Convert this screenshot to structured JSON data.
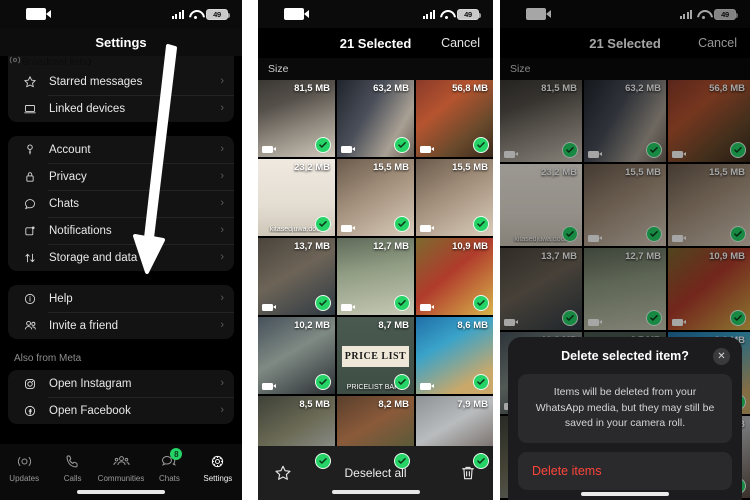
{
  "status_bar": {
    "camera_icon": "video-camera-icon",
    "signal_icon": "cellular-signal-icon",
    "wifi_icon": "wifi-icon",
    "battery_level": "49"
  },
  "panel_settings": {
    "header_title": "Settings",
    "cut_row_label": "Broadcast lists",
    "groups": [
      {
        "items": [
          {
            "icon": "star-icon",
            "label": "Starred messages",
            "chevron": "›"
          },
          {
            "icon": "laptop-icon",
            "label": "Linked devices",
            "chevron": "›"
          }
        ]
      },
      {
        "items": [
          {
            "icon": "key-icon",
            "label": "Account",
            "chevron": "›"
          },
          {
            "icon": "lock-icon",
            "label": "Privacy",
            "chevron": "›"
          },
          {
            "icon": "chat-bubble-icon",
            "label": "Chats",
            "chevron": "›"
          },
          {
            "icon": "bell-square-icon",
            "label": "Notifications",
            "chevron": "›"
          },
          {
            "icon": "arrows-updown-icon",
            "label": "Storage and data",
            "chevron": "›"
          }
        ]
      },
      {
        "items": [
          {
            "icon": "info-circle-icon",
            "label": "Help",
            "chevron": "›"
          },
          {
            "icon": "people-icon",
            "label": "Invite a friend",
            "chevron": "›"
          }
        ]
      }
    ],
    "meta_section_title": "Also from Meta",
    "meta_items": [
      {
        "icon": "instagram-icon",
        "label": "Open Instagram",
        "chevron": "›"
      },
      {
        "icon": "facebook-icon",
        "label": "Open Facebook",
        "chevron": "›"
      }
    ],
    "tabs": [
      {
        "icon": "updates-icon",
        "label": "Updates",
        "badge": ""
      },
      {
        "icon": "phone-icon",
        "label": "Calls",
        "badge": ""
      },
      {
        "icon": "communities-icon",
        "label": "Communities",
        "badge": ""
      },
      {
        "icon": "chats-icon",
        "label": "Chats",
        "badge": "8"
      },
      {
        "icon": "settings-gear-icon",
        "label": "Settings",
        "badge": ""
      }
    ],
    "active_tab": "Settings",
    "annotation": "white-down-arrow pointing to Storage and data"
  },
  "panel_media": {
    "header_selected": "21 Selected",
    "header_cancel": "Cancel",
    "sort_label": "Size",
    "bottom": {
      "favorite_icon": "star-outline-icon",
      "deselect_label": "Deselect all",
      "delete_icon": "trash-icon"
    },
    "cells": [
      {
        "size": "81,5 MB",
        "video": true,
        "selected": true,
        "caption": "",
        "banner": "",
        "art": "mall-corridor"
      },
      {
        "size": "63,2 MB",
        "video": true,
        "selected": true,
        "caption": "",
        "banner": "",
        "art": "cafe-people"
      },
      {
        "size": "56,8 MB",
        "video": true,
        "selected": true,
        "caption": "",
        "banner": "",
        "art": "food-table"
      },
      {
        "size": "23,2 MB",
        "video": false,
        "selected": true,
        "caption": "kitasedjuwa.docx",
        "banner": "",
        "art": "document-page"
      },
      {
        "size": "15,5 MB",
        "video": true,
        "selected": true,
        "caption": "",
        "banner": "",
        "art": "hand-drawing"
      },
      {
        "size": "15,5 MB",
        "video": true,
        "selected": true,
        "caption": "",
        "banner": "",
        "art": "hand-drawing"
      },
      {
        "size": "13,7 MB",
        "video": true,
        "selected": true,
        "caption": "",
        "banner": "",
        "art": "man-singing"
      },
      {
        "size": "12,7 MB",
        "video": true,
        "selected": true,
        "caption": "",
        "banner": "",
        "art": "hall-aisle"
      },
      {
        "size": "10,9 MB",
        "video": true,
        "selected": true,
        "caption": "",
        "banner": "",
        "art": "ceremony-red"
      },
      {
        "size": "10,2 MB",
        "video": true,
        "selected": true,
        "caption": "",
        "banner": "",
        "art": "indoor-meeting"
      },
      {
        "size": "8,7 MB",
        "video": false,
        "selected": true,
        "caption": "PRICELIST BARU",
        "banner": "PRICE LIST",
        "art": "price-list"
      },
      {
        "size": "8,6 MB",
        "video": true,
        "selected": true,
        "caption": "",
        "banner": "",
        "art": "registration-poster"
      },
      {
        "size": "8,5 MB",
        "video": false,
        "selected": true,
        "caption": "",
        "banner": "",
        "art": "car-interior"
      },
      {
        "size": "8,2 MB",
        "video": false,
        "selected": true,
        "caption": "",
        "banner": "",
        "art": "market-stall"
      },
      {
        "size": "7,9 MB",
        "video": false,
        "selected": true,
        "caption": "",
        "banner": "",
        "art": "car-passenger"
      }
    ]
  },
  "dialog": {
    "title": "Delete selected item?",
    "close_icon": "close-icon",
    "message": "Items will be deleted from your WhatsApp media, but they may still be saved in your camera roll.",
    "action_label": "Delete items"
  },
  "colors": {
    "accent_green": "#25D366",
    "destructive_red": "#FF453A",
    "panel_bg": "#000000",
    "card_bg": "#131313"
  }
}
